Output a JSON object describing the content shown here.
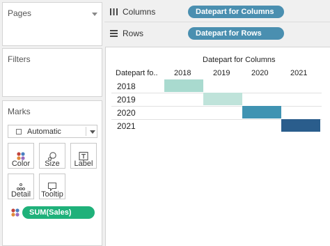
{
  "pages_card": {
    "title": "Pages"
  },
  "filters_card": {
    "title": "Filters"
  },
  "marks_card": {
    "title": "Marks",
    "mark_type": "Automatic",
    "buttons": [
      {
        "label": "Color",
        "icon": "color-dots-icon"
      },
      {
        "label": "Size",
        "icon": "size-icon"
      },
      {
        "label": "Label",
        "icon": "label-icon"
      },
      {
        "label": "Detail",
        "icon": "detail-icon"
      },
      {
        "label": "Tooltip",
        "icon": "tooltip-icon"
      }
    ],
    "field_pill": "SUM(Sales)",
    "pill_color": "#1fb17a"
  },
  "shelves": {
    "columns_label": "Columns",
    "columns_pill": "Datepart for Columns",
    "rows_label": "Rows",
    "rows_pill": "Datepart for Rows",
    "pill_color": "#4a8fb0"
  },
  "view": {
    "column_header_title": "Datepart for Columns",
    "row_header_title": "Datepart fo..",
    "columns": [
      "2018",
      "2019",
      "2020",
      "2021"
    ],
    "rows": [
      "2018",
      "2019",
      "2020",
      "2021"
    ],
    "cells": [
      {
        "row": "2018",
        "column": "2018",
        "color": "#a9dacf"
      },
      {
        "row": "2019",
        "column": "2019",
        "color": "#bfe3da"
      },
      {
        "row": "2020",
        "column": "2020",
        "color": "#3f93b2"
      },
      {
        "row": "2021",
        "column": "2021",
        "color": "#2a5d8c"
      }
    ]
  }
}
